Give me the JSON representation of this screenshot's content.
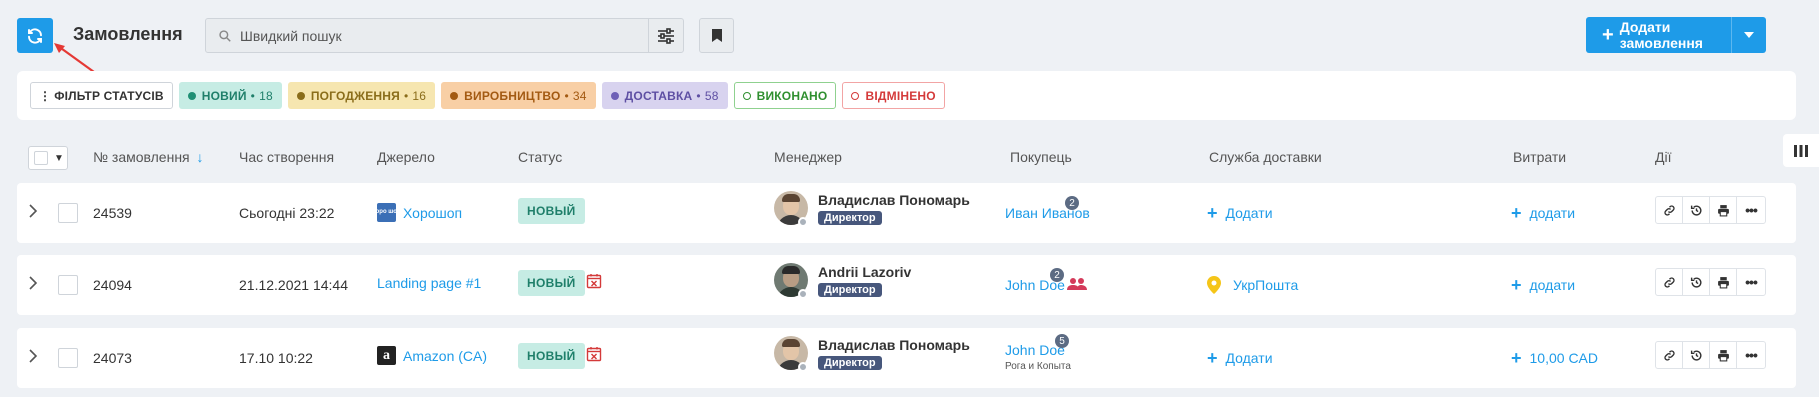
{
  "header": {
    "title": "Замовлення",
    "search_placeholder": "Швидкий пошук",
    "add_order_label": "Додати замовлення"
  },
  "status_filters": {
    "filter_label": "ФІЛЬТР СТАТУСІВ",
    "items": [
      {
        "label": "НОВИЙ",
        "count": "18"
      },
      {
        "label": "ПОГОДЖЕННЯ",
        "count": "16"
      },
      {
        "label": "ВИРОБНИЦТВО",
        "count": "34"
      },
      {
        "label": "ДОСТАВКА",
        "count": "58"
      },
      {
        "label": "ВИКОНАНО",
        "count": ""
      },
      {
        "label": "ВІДМІНЕНО",
        "count": ""
      }
    ]
  },
  "table": {
    "columns": [
      "№ замовлення",
      "Час створення",
      "Джерело",
      "Статус",
      "Менеджер",
      "Покупець",
      "Служба доставки",
      "Витрати",
      "Дії"
    ],
    "rows": [
      {
        "order_number": "24539",
        "created": "Сьогодні 23:22",
        "source": "Хорошоп",
        "source_logo": "хоро шоп",
        "status": "НОВЫЙ",
        "manager_name": "Владислав Пономарь",
        "manager_role": "Директор",
        "buyer_name": "Иван Иванов",
        "buyer_badge": "2",
        "buyer_sub": "",
        "delivery": "Додати",
        "costs": "додати"
      },
      {
        "order_number": "24094",
        "created": "21.12.2021 14:44",
        "source": "Landing page #1",
        "source_logo": "",
        "status": "НОВЫЙ",
        "manager_name": "Andrii Lazoriv",
        "manager_role": "Директор",
        "buyer_name": "John Doe",
        "buyer_badge": "2",
        "buyer_sub": "",
        "delivery": "УкрПошта",
        "costs": "додати"
      },
      {
        "order_number": "24073",
        "created": "17.10 10:22",
        "source": "Amazon (CA)",
        "source_logo": "a",
        "status": "НОВЫЙ",
        "manager_name": "Владислав Пономарь",
        "manager_role": "Директор",
        "buyer_name": "John Doe",
        "buyer_badge": "5",
        "buyer_sub": "Рога и Копыта",
        "delivery": "Додати",
        "costs": "10,00 CAD"
      }
    ]
  },
  "colors": {
    "accent": "#1e9be8",
    "status_new_bg": "#c6ece4",
    "annotation_arrow": "#e53935"
  }
}
